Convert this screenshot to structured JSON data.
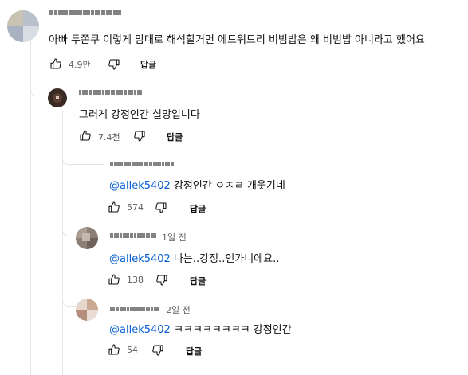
{
  "comments": [
    {
      "text": "아빠 두쫀쿠 이렇게 맘대로 해석할거먼 에드워드리 비빔밥은 왜 비빔밥 아니라고 했어요",
      "likes": "4.9만",
      "reply_label": "답글"
    },
    {
      "text": "그러게 강정인간 실망입니다",
      "likes": "7.4천",
      "reply_label": "답글"
    },
    {
      "mention": "@allek5402",
      "text": "강정인간 ㅇㅈㄹ 개웃기네",
      "likes": "574",
      "reply_label": "답글"
    },
    {
      "time": "1일 전",
      "mention": "@allek5402",
      "text": "나는..강정..인가니에요..",
      "likes": "138",
      "reply_label": "답글"
    },
    {
      "time": "2일 전",
      "mention": "@allek5402",
      "text": "ㅋㅋㅋㅋㅋㅋㅋㅋ 강정인간",
      "likes": "54",
      "reply_label": "답글"
    }
  ],
  "icons": {
    "like": "thumbs-up-icon",
    "dislike": "thumbs-down-icon"
  },
  "colors": {
    "mention": "#065fd4",
    "meta": "#606060",
    "thread_line": "#e5e5e5"
  }
}
